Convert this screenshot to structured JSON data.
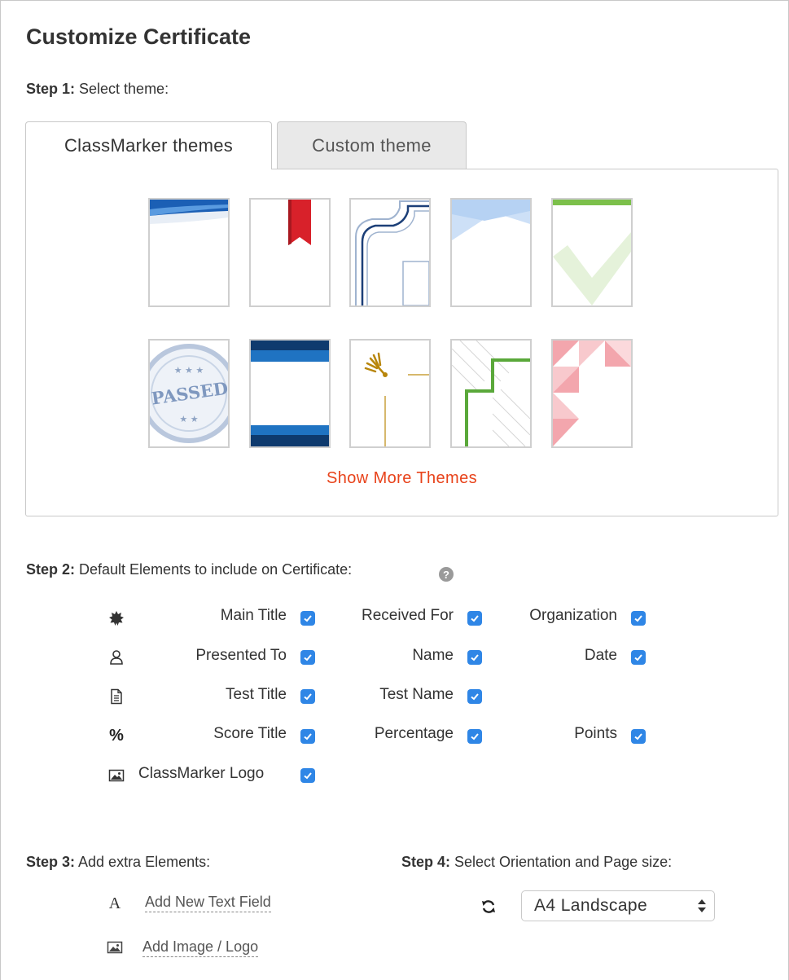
{
  "page": {
    "title": "Customize Certificate"
  },
  "step1": {
    "prefix": "Step 1:",
    "text": " Select theme:",
    "tabs": [
      {
        "label": "ClassMarker themes",
        "active": true
      },
      {
        "label": "Custom theme",
        "active": false
      }
    ],
    "themes": [
      "blue-wave",
      "red-ribbon",
      "navy-frame",
      "light-blue-angles",
      "green-check",
      "passed-stamp",
      "blue-bands",
      "gold-fern",
      "green-step",
      "pink-triangles"
    ],
    "stamp_text": "PASSED",
    "show_more": "Show More Themes"
  },
  "step2": {
    "prefix": "Step 2:",
    "text": " Default Elements to include on Certificate:",
    "help_glyph": "?",
    "rows": [
      {
        "icon": "badge-icon",
        "items": [
          {
            "label": "Main Title",
            "checked": true
          },
          {
            "label": "Received For",
            "checked": true
          },
          {
            "label": "Organization",
            "checked": true
          }
        ]
      },
      {
        "icon": "user-icon",
        "items": [
          {
            "label": "Presented To",
            "checked": true
          },
          {
            "label": "Name",
            "checked": true
          },
          {
            "label": "Date",
            "checked": true
          }
        ]
      },
      {
        "icon": "document-icon",
        "items": [
          {
            "label": "Test Title",
            "checked": true
          },
          {
            "label": "Test Name",
            "checked": true
          }
        ]
      },
      {
        "icon": "percent-icon",
        "icon_glyph": "%",
        "items": [
          {
            "label": "Score Title",
            "checked": true
          },
          {
            "label": "Percentage",
            "checked": true
          },
          {
            "label": "Points",
            "checked": true
          }
        ]
      },
      {
        "icon": "image-icon",
        "items": [
          {
            "label": "ClassMarker Logo",
            "checked": true
          }
        ]
      }
    ]
  },
  "step3": {
    "prefix": "Step 3:",
    "text": " Add extra Elements:",
    "text_glyph": "A",
    "add_text": "Add New Text Field",
    "add_image": "Add Image / Logo"
  },
  "step4": {
    "prefix": "Step 4:",
    "text": " Select Orientation and Page size:",
    "selected": "A4 Landscape"
  },
  "colors": {
    "accent_blue": "#2f86e6",
    "link_orange": "#e8431b"
  }
}
